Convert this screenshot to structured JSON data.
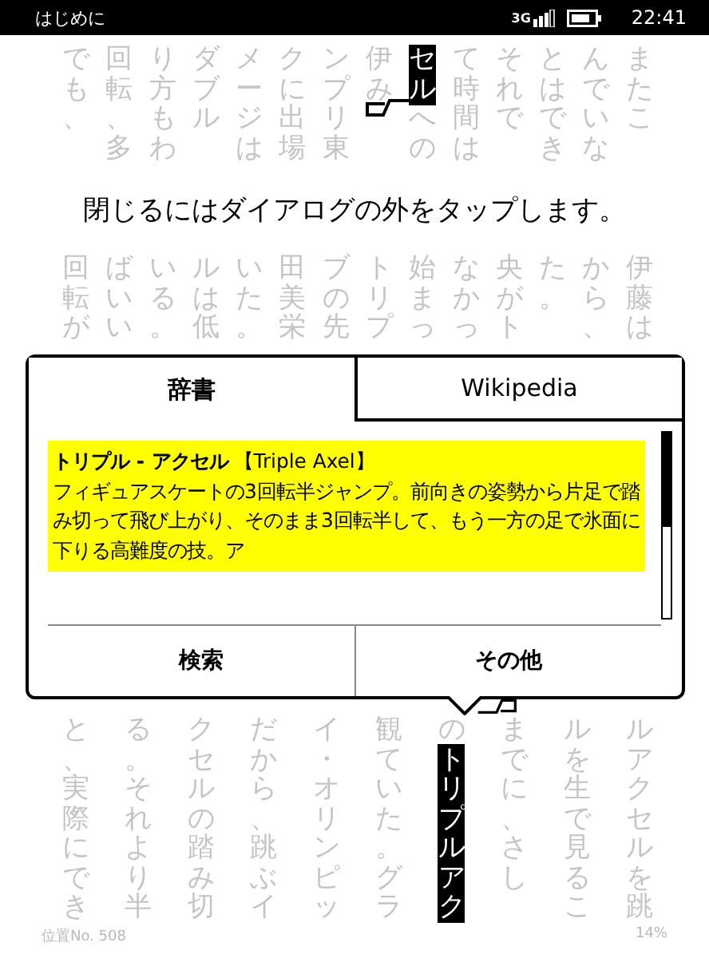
{
  "status_bar": {
    "title": "はじめに",
    "network": "3G",
    "time": "22:41"
  },
  "page_top": {
    "columns": [
      {
        "segments": [
          {
            "text": "でも、",
            "selected": false
          }
        ]
      },
      {
        "segments": [
          {
            "text": "回転、多",
            "selected": false
          }
        ]
      },
      {
        "segments": [
          {
            "text": "り方もわ",
            "selected": false
          }
        ]
      },
      {
        "segments": [
          {
            "text": "ダブル",
            "selected": false
          }
        ]
      },
      {
        "segments": [
          {
            "text": "メージは",
            "selected": false
          }
        ]
      },
      {
        "segments": [
          {
            "text": "クに出場",
            "selected": false
          }
        ]
      },
      {
        "segments": [
          {
            "text": "ンプリ東",
            "selected": false
          }
        ]
      },
      {
        "segments": [
          {
            "text": "伊み",
            "selected": false
          }
        ]
      },
      {
        "segments": [
          {
            "text": "セル",
            "selected": true
          },
          {
            "text": "への",
            "selected": false
          }
        ]
      },
      {
        "segments": [
          {
            "text": "て時間は",
            "selected": false
          }
        ]
      },
      {
        "segments": [
          {
            "text": "それで",
            "selected": false
          }
        ]
      },
      {
        "segments": [
          {
            "text": "とはでき",
            "selected": false
          }
        ]
      },
      {
        "segments": [
          {
            "text": "んでいな",
            "selected": false
          }
        ]
      },
      {
        "segments": [
          {
            "text": "またこ",
            "selected": false
          }
        ]
      }
    ]
  },
  "hint": "閉じるにはダイアログの外をタップします。",
  "page_middle": {
    "columns": [
      {
        "segments": [
          {
            "text": "回転が",
            "selected": false
          }
        ]
      },
      {
        "segments": [
          {
            "text": "ばいい",
            "selected": false
          }
        ]
      },
      {
        "segments": [
          {
            "text": "いる。",
            "selected": false
          }
        ]
      },
      {
        "segments": [
          {
            "text": "ルは低",
            "selected": false
          }
        ]
      },
      {
        "segments": [
          {
            "text": "いた。",
            "selected": false
          }
        ]
      },
      {
        "segments": [
          {
            "text": "田美栄",
            "selected": false
          }
        ]
      },
      {
        "segments": [
          {
            "text": "ブの先",
            "selected": false
          }
        ]
      },
      {
        "segments": [
          {
            "text": "トリプ",
            "selected": false
          }
        ]
      },
      {
        "segments": [
          {
            "text": "始まっ",
            "selected": false
          }
        ]
      },
      {
        "segments": [
          {
            "text": "なかっ",
            "selected": false
          }
        ]
      },
      {
        "segments": [
          {
            "text": "央がト",
            "selected": false
          }
        ]
      },
      {
        "segments": [
          {
            "text": "た。",
            "selected": false
          }
        ]
      },
      {
        "segments": [
          {
            "text": "から、",
            "selected": false
          }
        ]
      },
      {
        "segments": [
          {
            "text": "伊藤は",
            "selected": false
          }
        ]
      }
    ]
  },
  "dialog": {
    "tabs": [
      {
        "label": "辞書",
        "selected": true
      },
      {
        "label": "Wikipedia",
        "selected": false
      }
    ],
    "entry": {
      "headword": "トリプル - アクセル",
      "original": "【Triple Axel】",
      "definition": "フィギュアスケートの3回転半ジャンプ。前向きの姿勢から片足で踏み切って飛び上がり、そのまま3回転半して、もう一方の足で氷面に下りる高難度の技。ア"
    },
    "buttons": [
      "検索",
      "その他"
    ]
  },
  "page_bottom": {
    "columns": [
      {
        "segments": [
          {
            "text": "と、実際にでき",
            "selected": false
          }
        ]
      },
      {
        "segments": [
          {
            "text": "る。それより半",
            "selected": false
          }
        ]
      },
      {
        "segments": [
          {
            "text": "クセルの踏み切",
            "selected": false
          }
        ]
      },
      {
        "segments": [
          {
            "text": "だから、跳ぶイ",
            "selected": false
          }
        ]
      },
      {
        "segments": [
          {
            "text": "イ・オリンピッ",
            "selected": false
          }
        ]
      },
      {
        "segments": [
          {
            "text": "観ていた。グラ",
            "selected": false
          }
        ]
      },
      {
        "segments": [
          {
            "text": "の",
            "selected": false
          },
          {
            "text": "トリプルアク",
            "selected": true
          }
        ]
      },
      {
        "segments": [
          {
            "text": "までに、さし",
            "selected": false
          }
        ]
      },
      {
        "segments": [
          {
            "text": "ルを生で見るこ",
            "selected": false
          }
        ]
      },
      {
        "segments": [
          {
            "text": "ルアクセルを跳",
            "selected": false
          }
        ]
      }
    ]
  },
  "footer": {
    "location": "位置No. 508",
    "percent": "14%"
  }
}
